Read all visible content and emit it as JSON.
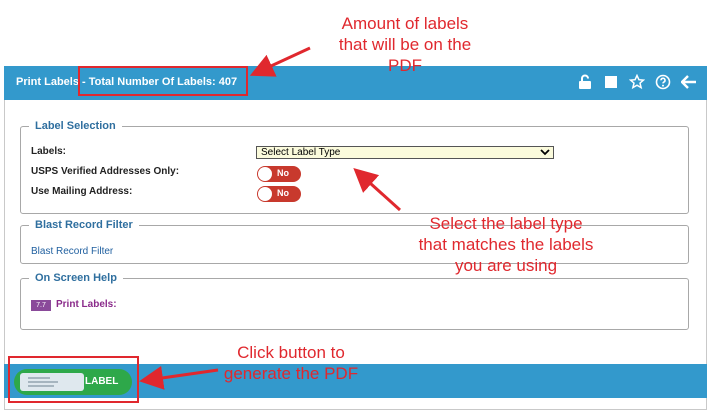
{
  "header": {
    "title_prefix": "Print Labels",
    "title_separator": " - ",
    "title_count": "Total Number Of Labels: 407",
    "icons": [
      "unlock-icon",
      "stop-icon",
      "star-icon",
      "help-icon",
      "back-arrow-icon"
    ]
  },
  "label_selection": {
    "legend": "Label Selection",
    "labels_label": "Labels:",
    "labels_value": "Select Label Type",
    "usps_label": "USPS Verified Addresses Only:",
    "usps_value": "No",
    "mailing_label": "Use Mailing Address:",
    "mailing_value": "No"
  },
  "blast_filter": {
    "legend": "Blast Record Filter",
    "link": "Blast Record Filter"
  },
  "help": {
    "legend": "On Screen Help",
    "badge": "7.7",
    "text": "Print Labels:"
  },
  "footer": {
    "button_label": "LABEL"
  },
  "annotations": {
    "top_1": "Amount of labels",
    "top_2": "that will be on the",
    "top_3": "PDF",
    "mid_1": "Select the label type",
    "mid_2": "that matches the labels",
    "mid_3": "you are using",
    "bot_1": "Click button to",
    "bot_2": "generate the PDF",
    "color": "#e0282e"
  },
  "colors": {
    "header_bg": "#3399cc",
    "button_green": "#2ea84a",
    "toggle_red": "#c8392d"
  }
}
